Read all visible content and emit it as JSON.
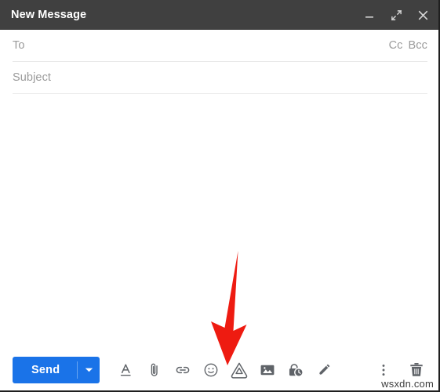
{
  "window": {
    "title": "New Message",
    "controls": [
      {
        "name": "minimize",
        "label": "Minimize",
        "icon": "minimize-icon"
      },
      {
        "name": "expand",
        "label": "Full screen",
        "icon": "expand-icon"
      },
      {
        "name": "close",
        "label": "Save & close",
        "icon": "close-icon"
      }
    ]
  },
  "compose": {
    "to": {
      "label": "To",
      "value": "",
      "placeholder": "To"
    },
    "cc_label": "Cc",
    "bcc_label": "Bcc",
    "subject": {
      "label": "Subject",
      "value": "",
      "placeholder": "Subject"
    },
    "body": {
      "value": "",
      "placeholder": ""
    }
  },
  "toolbar": {
    "send_label": "Send",
    "send_caret_label": "More send options",
    "send_color": "#1a73e8",
    "items": [
      {
        "name": "formatting-options",
        "label": "Formatting options",
        "icon": "format-text-icon"
      },
      {
        "name": "attach-files",
        "label": "Attach files",
        "icon": "paperclip-icon"
      },
      {
        "name": "insert-link",
        "label": "Insert link",
        "icon": "link-icon"
      },
      {
        "name": "insert-emoji",
        "label": "Insert emoji",
        "icon": "emoji-icon"
      },
      {
        "name": "insert-drive",
        "label": "Insert files using Drive",
        "icon": "google-drive-icon"
      },
      {
        "name": "insert-photo",
        "label": "Insert photo",
        "icon": "image-icon"
      },
      {
        "name": "confidential-mode",
        "label": "Toggle confidential mode",
        "icon": "lock-clock-icon"
      },
      {
        "name": "insert-signature",
        "label": "Insert signature",
        "icon": "pen-icon"
      }
    ],
    "right_items": [
      {
        "name": "more-options",
        "label": "More options",
        "icon": "kebab-menu-icon"
      },
      {
        "name": "discard-draft",
        "label": "Discard draft",
        "icon": "trash-icon"
      }
    ]
  },
  "annotation": {
    "arrow_color": "#ee1b11",
    "points_to": "insert-drive"
  },
  "watermark": {
    "text": "wsxdn.com"
  }
}
